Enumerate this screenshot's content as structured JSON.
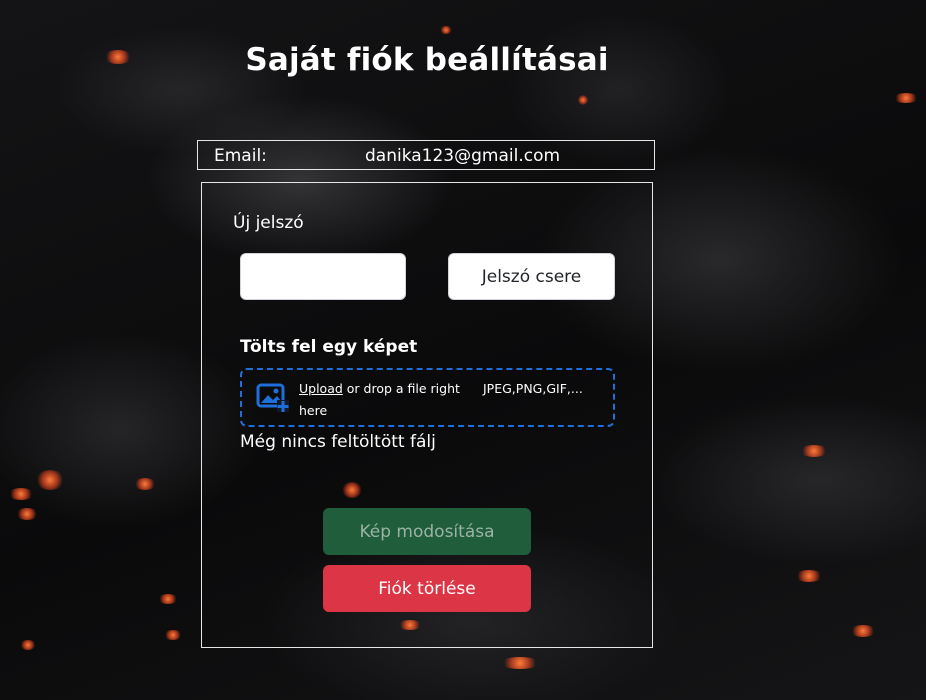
{
  "page": {
    "title": "Saját fiók beállításai"
  },
  "account": {
    "email_label": "Email:",
    "email_value": "danika123@gmail.com"
  },
  "password": {
    "label": "Új jelszó",
    "input_value": "",
    "change_button": "Jelszó csere"
  },
  "upload": {
    "title": "Tölts fel egy képet",
    "link_text": "Upload",
    "drop_text": " or drop a file right here",
    "types_text": "JPEG,PNG,GIF,...",
    "icon": "image-upload-icon",
    "status": "Még nincs feltöltött fálj"
  },
  "actions": {
    "modify_button": "Kép modosítása",
    "delete_button": "Fiók törlése"
  },
  "colors": {
    "background": "#0b0b0d",
    "text": "#ffffff",
    "dropzone_border": "#1e6fd9",
    "success": "#1f5d3b",
    "danger": "#dc3545"
  }
}
